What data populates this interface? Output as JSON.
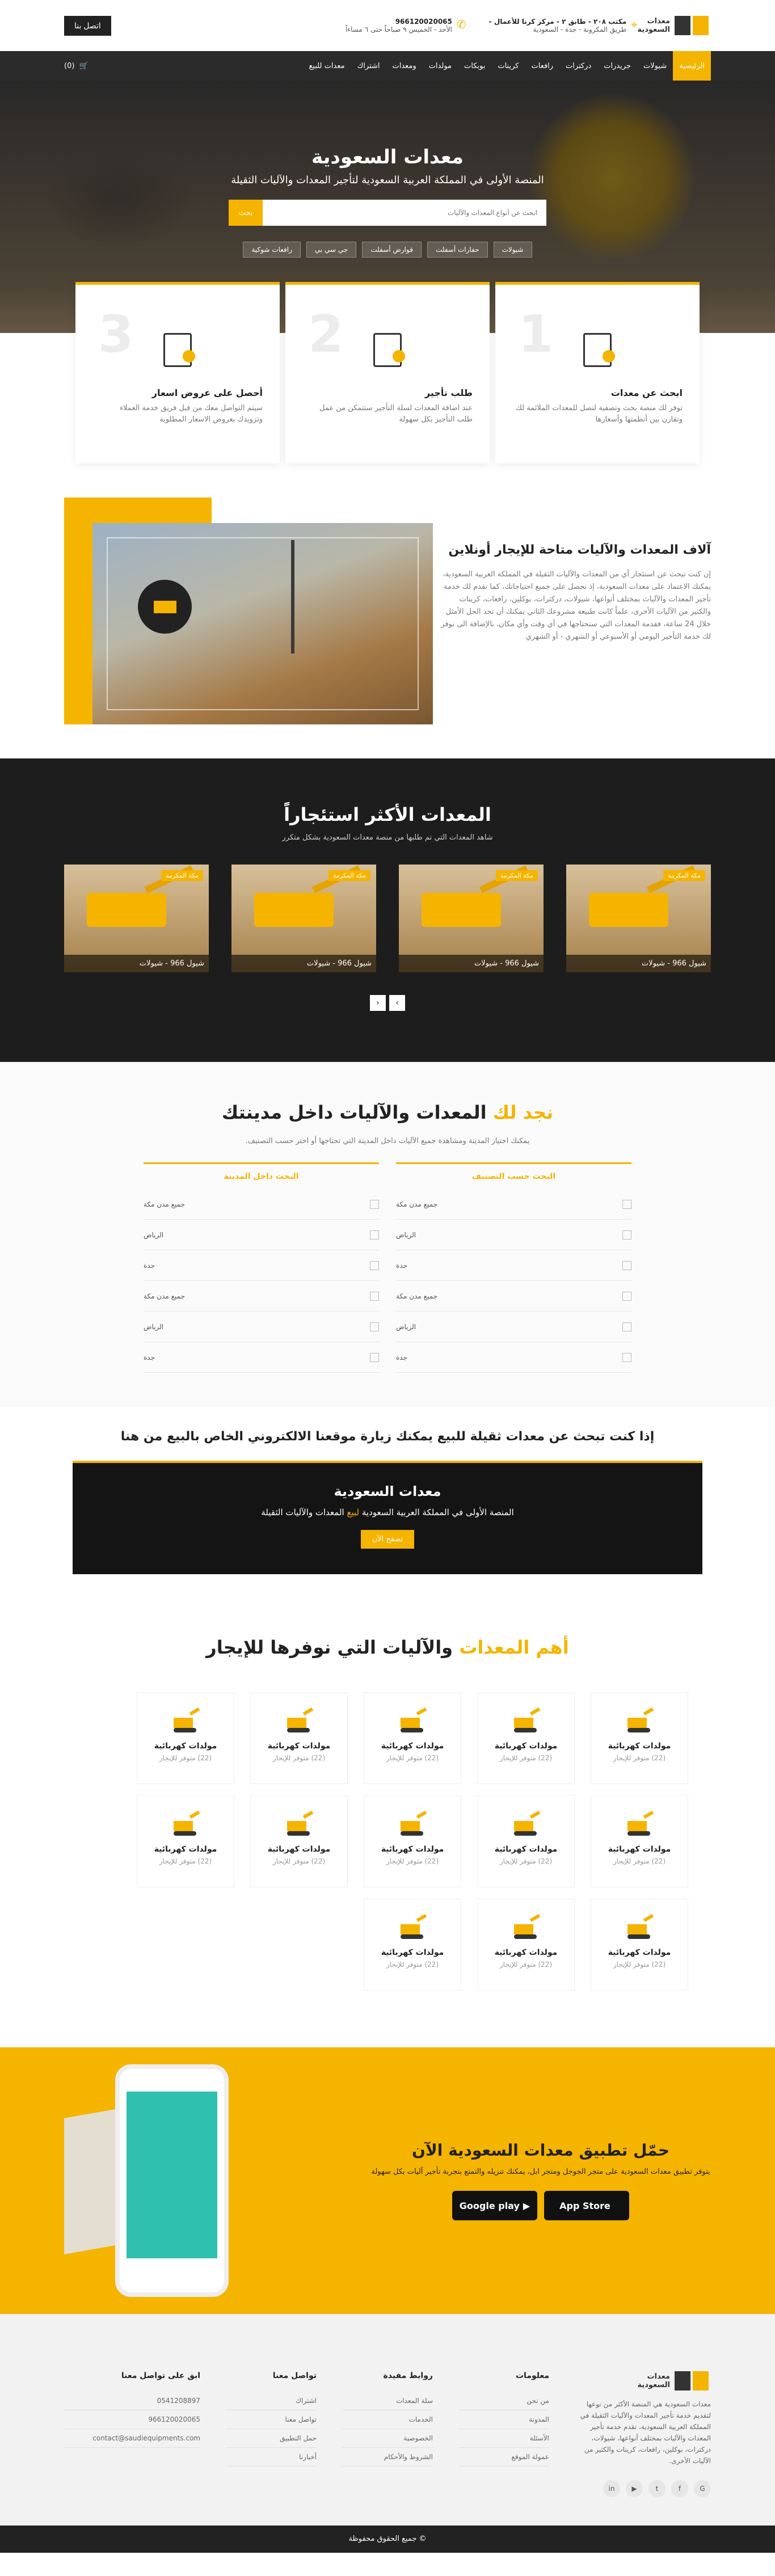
{
  "topbar": {
    "logo_line1": "معدات",
    "logo_line2": "السعودية",
    "address_title": "مكتب ٢٠٨ - طابق ٢ - مركز كرنا للأعمال -",
    "address_sub": "طريق المكرونة - جدة - السعودية",
    "phone": "966120020065",
    "hours": "الأحد - الخميس ٩ صباحاً حتى ٦ مساءاً",
    "contact_btn": "اتصل بنا"
  },
  "nav": {
    "items": [
      "الرئيسية",
      "شيولات",
      "جريدرات",
      "دركترات",
      "رافعات",
      "كرينات",
      "بوبكات",
      "مولدات",
      "ومعدات",
      "اشتراك",
      "معدات للبيع"
    ],
    "cart_count": "(0)"
  },
  "hero": {
    "title": "معدات السعودية",
    "subtitle": "المنصة الأولى في المملكة العربية السعودية لتأجير المعدات والآليات الثقيلة",
    "search_placeholder": "ابحث عن أنواع المعدات والآليات",
    "search_btn": "بحث",
    "tags": [
      "شيولات",
      "حفارات أسفلت",
      "قوارض أسفلت",
      "جي سي بي",
      "رافعات شوكية"
    ]
  },
  "steps": [
    {
      "num": "1",
      "title": "ابحث عن معدات",
      "text": "توفر لك منصة بحث وتصفية لتصل للمعدات الملائمة لك وتقارن بين أنظمتها وأسعارها"
    },
    {
      "num": "2",
      "title": "طلب تأجير",
      "text": "عند اضافة المعدات لسلة التأجير ستتمكن من عمل طلب التأجير بكل سهولة"
    },
    {
      "num": "3",
      "title": "أحصل على عروض اسعار",
      "text": "سيتم التواصل معك من قبل فريق خدمة العملاء وتزويدك بعروض الاسعار المطلوبة"
    }
  ],
  "about": {
    "title": "آلاف المعدات والآليات متاحة للإيجار أونلاين",
    "body": "إن كنت تبحث عن استئجار أي من المعدات والآليات الثقيلة في المملكة العربية السعودية، يمكنك الاعتماد على معدات السعودية، إذ نحصل على جميع احتياجاتك، كما تقدم لك خدمة تأجير المعدات والآليات بمختلف أنواعها، شيولات، دركترات، بوكلين، رافعات، كرينات والكثير من الآليات الأخرى، علماً كانت طبيعة مشروعك الثاني يمكنك أن تجد الحل الأمثل خلال 24 ساعة، فقدمة المعدات التي ستحتاجها في أي وقت وأي مكان، بالإضافة الى نوفر لك خدمة التأجير اليومي أو الأسبوعي أو الشهري - أو الشهري"
  },
  "most_rented": {
    "title": "المعدات الأكثر استئجاراً",
    "subtitle": "شاهد المعدات التي تم طلبها من منصة معدات السعودية بشكل متكرر",
    "cards": [
      {
        "badge": "مكة المكرمة",
        "caption": "شيول 966 - شيولات"
      },
      {
        "badge": "مكة المكرمة",
        "caption": "شيول 966 - شيولات"
      },
      {
        "badge": "مكة المكرمة",
        "caption": "شيول 966 - شيولات"
      },
      {
        "badge": "مكة المكرمة",
        "caption": "شيول 966 - شيولات"
      }
    ],
    "prev": "‹",
    "next": "›"
  },
  "find": {
    "title_hl": "نجد لك",
    "title_rest": "المعدات والآليات داخل مدينتك",
    "subtitle": "يمكنك اختيار المدينة ومشاهدة جميع الآليات داخل المدينة التي تحتاجها أو اختر حسب التصنيف.",
    "col_category": "البحث حسب التصنيف",
    "col_city": "البحث داخل المدينة",
    "category_rows": [
      "جميع مدن مكة",
      "الرياض",
      "جدة",
      "جميع مدن مكة",
      "الرياض",
      "جدة"
    ],
    "city_rows": [
      "جميع مدن مكة",
      "الرياض",
      "جدة",
      "جميع مدن مكة",
      "الرياض",
      "جدة"
    ]
  },
  "sale": {
    "title": "إذا كنت تبحث عن معدات ثقيلة للبيع يمكنك زيارة موقعنا الالكتروني الخاص بالبيع من هنا",
    "banner_title": "معدات السعودية",
    "banner_sub_pre": "المنصة الأولى في المملكة العربية السعودية",
    "banner_sub_hl": "لبيع",
    "banner_sub_post": "المعدات والآليات الثقيلة",
    "banner_btn": "تصفح الآن"
  },
  "types": {
    "title_hl": "أهم المعدات",
    "title_rest": "والآليات التي نوفرها للإيجار",
    "items": [
      {
        "name": "مولدات كهربائية",
        "count": "(22) متوفر للإيجار"
      },
      {
        "name": "مولدات كهربائية",
        "count": "(22) متوفر للإيجار"
      },
      {
        "name": "مولدات كهربائية",
        "count": "(22) متوفر للإيجار"
      },
      {
        "name": "مولدات كهربائية",
        "count": "(22) متوفر للإيجار"
      },
      {
        "name": "مولدات كهربائية",
        "count": "(22) متوفر للإيجار"
      },
      {
        "name": "مولدات كهربائية",
        "count": "(22) متوفر للإيجار"
      },
      {
        "name": "مولدات كهربائية",
        "count": "(22) متوفر للإيجار"
      },
      {
        "name": "مولدات كهربائية",
        "count": "(22) متوفر للإيجار"
      },
      {
        "name": "مولدات كهربائية",
        "count": "(22) متوفر للإيجار"
      },
      {
        "name": "مولدات كهربائية",
        "count": "(22) متوفر للإيجار"
      },
      {
        "name": "مولدات كهربائية",
        "count": "(22) متوفر للإيجار"
      },
      {
        "name": "مولدات كهربائية",
        "count": "(22) متوفر للإيجار"
      },
      {
        "name": "مولدات كهربائية",
        "count": "(22) متوفر للإيجار"
      }
    ]
  },
  "app": {
    "title": "حمّل تطبيق معدات السعودية الآن",
    "subtitle": "يتوفر تطبيق معدات السعودية على متجر الجوجل ومتجر ابل، يمكنك تنزيله والتمتع بتجربة تأجير آليات بكل سهولة",
    "appstore": "App Store",
    "googleplay": "Google play"
  },
  "footer": {
    "about": "معدات السعودية هي المنصة الأكثر من نوعها لتقديم خدمة تأجير المعدات والآليات الثقيلة في المملكة العربية السعودية، تقدم خدمة تأجير المعدات والآليات بمختلف أنواعها، شيولات، دركترات، بوكلين، رافعات، كرينات والكثير من الآليات الأخرى.",
    "col1_head": "معلومات",
    "col1_links": [
      "من نحن",
      "المدونة",
      "الأسئلة",
      "عمولة الموقع"
    ],
    "col2_head": "روابط مفيدة",
    "col2_links": [
      "سلة المعدات",
      "الخدمات",
      "الخصوصية",
      "الشروط والأحكام"
    ],
    "col3_head": "تواصل معنا",
    "col3_links": [
      "اشتراك",
      "تواصل معنا",
      "حمل التطبيق",
      "أخبارنا"
    ],
    "col4_head": "ابق على تواصل معنا",
    "phone1": "0541208897",
    "phone2": "966120020065",
    "email": "contact@saudiequipments.com",
    "socials": [
      "G",
      "f",
      "t",
      "▶",
      "in"
    ],
    "copyright": "© جميع الحقوق محفوظة"
  },
  "colors": {
    "accent": "#f5b400",
    "dark": "#2b2b2b"
  }
}
